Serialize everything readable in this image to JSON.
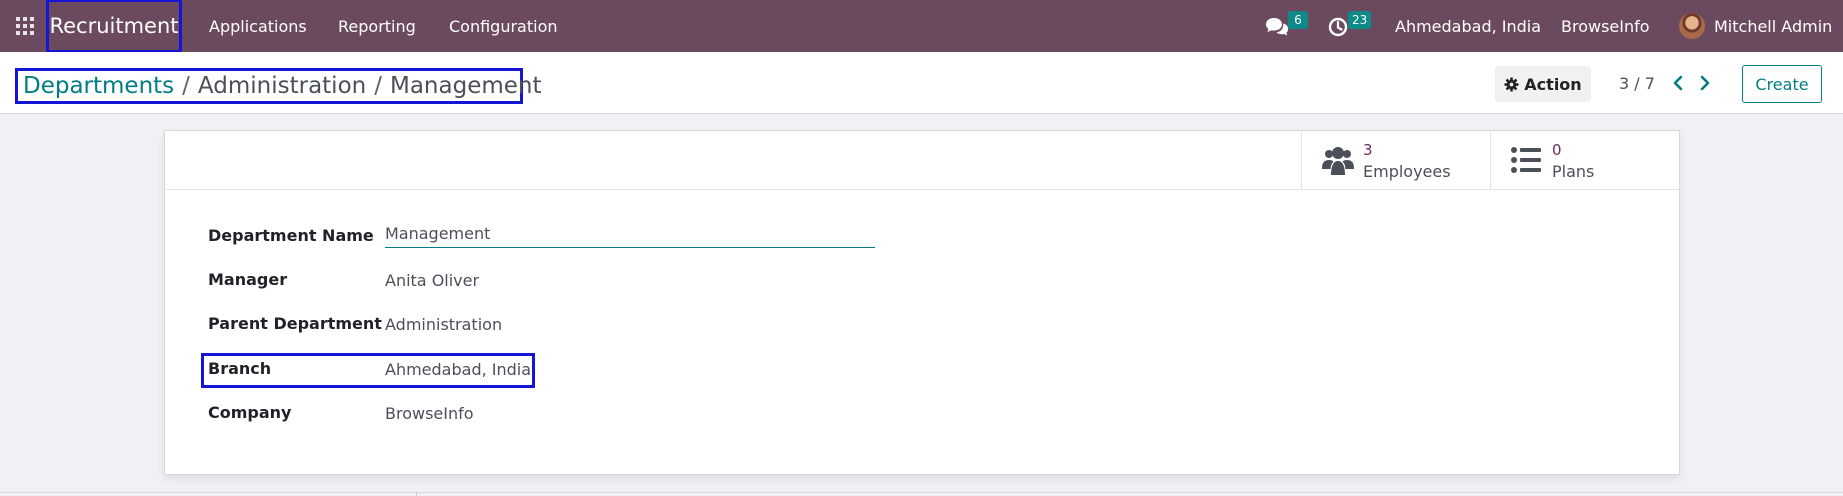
{
  "navbar": {
    "app_name": "Recruitment",
    "menu": [
      "Applications",
      "Reporting",
      "Configuration"
    ],
    "messages_badge": "6",
    "activities_badge": "23",
    "branch": "Ahmedabad, India",
    "company": "BrowseInfo",
    "user": "Mitchell Admin"
  },
  "control_panel": {
    "breadcrumb": [
      "Departments",
      "Administration",
      "Management"
    ],
    "action_label": "Action",
    "pager": "3 / 7",
    "create_label": "Create"
  },
  "stat_buttons": [
    {
      "value": "3",
      "label": "Employees",
      "icon": "users-icon"
    },
    {
      "value": "0",
      "label": "Plans",
      "icon": "list-icon"
    }
  ],
  "form": {
    "fields": [
      {
        "label": "Department Name",
        "value": "Management"
      },
      {
        "label": "Manager",
        "value": "Anita Oliver"
      },
      {
        "label": "Parent Department",
        "value": "Administration"
      },
      {
        "label": "Branch",
        "value": "Ahmedabad, India"
      },
      {
        "label": "Company",
        "value": "BrowseInfo"
      }
    ]
  },
  "colors": {
    "navbar": "#6b4a60",
    "accent": "#017e84",
    "badge": "#0e8a88",
    "highlight": "#1515d6",
    "stat_value": "#6b2d5a"
  }
}
